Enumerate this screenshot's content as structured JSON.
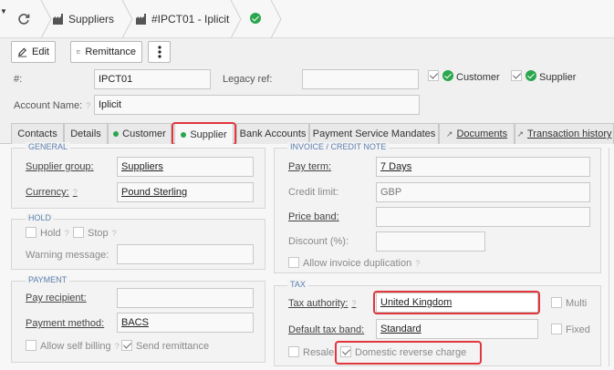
{
  "breadcrumb": {
    "item1": "Suppliers",
    "item2": "#IPCT01 - Iplicit"
  },
  "toolbar": {
    "edit": "Edit",
    "remittance": "Remittance"
  },
  "header": {
    "id_label": "#:",
    "id_value": "IPCT01",
    "legacy_label": "Legacy ref:",
    "legacy_value": "",
    "customer_label": "Customer",
    "supplier_label": "Supplier",
    "account_name_label": "Account Name:",
    "account_name_value": "Iplicit"
  },
  "tabs": [
    {
      "label": "Contacts"
    },
    {
      "label": "Details"
    },
    {
      "label": "Customer"
    },
    {
      "label": "Supplier"
    },
    {
      "label": "Bank Accounts"
    },
    {
      "label": "Payment Service Mandates"
    },
    {
      "label": "Documents"
    },
    {
      "label": "Transaction history"
    }
  ],
  "general": {
    "title": "GENERAL",
    "supplier_group_label": "Supplier group:",
    "supplier_group_value": "Suppliers",
    "currency_label": "Currency:",
    "currency_value": "Pound Sterling"
  },
  "hold": {
    "title": "HOLD",
    "hold_label": "Hold",
    "stop_label": "Stop",
    "warning_label": "Warning message:",
    "warning_value": ""
  },
  "payment": {
    "title": "PAYMENT",
    "pay_recipient_label": "Pay recipient:",
    "pay_recipient_value": "",
    "payment_method_label": "Payment method:",
    "payment_method_value": "BACS",
    "allow_self_billing_label": "Allow self billing",
    "send_remittance_label": "Send remittance"
  },
  "invoice": {
    "title": "INVOICE / CREDIT NOTE",
    "pay_term_label": "Pay term:",
    "pay_term_value": "7 Days",
    "credit_limit_label": "Credit limit:",
    "credit_limit_value": "GBP",
    "price_band_label": "Price band:",
    "price_band_value": "",
    "discount_label": "Discount (%):",
    "discount_value": "",
    "allow_dup_label": "Allow invoice duplication"
  },
  "tax": {
    "title": "TAX",
    "authority_label": "Tax authority:",
    "authority_value": "United Kingdom",
    "multi_label": "Multi",
    "default_band_label": "Default tax band:",
    "default_band_value": "Standard",
    "fixed_label": "Fixed",
    "resale_label": "Resale",
    "domestic_label": "Domestic reverse charge"
  },
  "colors": {
    "accent_green": "#2aa64d",
    "highlight_red": "#e0363c",
    "section_blue": "#5b7fb0"
  }
}
